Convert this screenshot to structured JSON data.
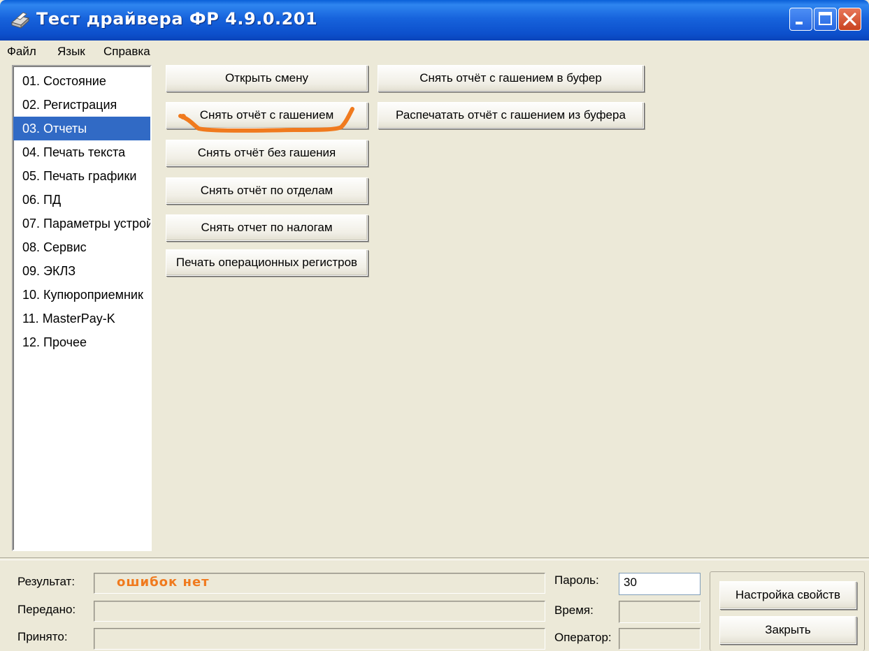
{
  "window": {
    "title": "Тест драйвера ФР 4.9.0.201",
    "icons": [
      "app-printer-icon",
      "minimize-icon",
      "maximize-icon",
      "close-icon"
    ]
  },
  "menu": [
    "Файл",
    "Язык",
    "Справка"
  ],
  "nav": {
    "items": [
      "01. Состояние",
      "02. Регистрация",
      "03. Отчеты",
      "04. Печать текста",
      "05. Печать графики",
      "06. ПД",
      "07. Параметры устрой",
      "08. Сервис",
      "09. ЭКЛЗ",
      "10. Купюроприемник",
      "11. MasterPay-K",
      "12. Прочее"
    ],
    "selected": "03. Отчеты"
  },
  "reports": {
    "col1": [
      "Открыть смену",
      "Снять отчёт с гашением",
      "Снять отчёт без гашения",
      "Снять отчёт по отделам",
      "Снять отчет по налогам",
      "Печать операционных регистров"
    ],
    "col2": [
      "Снять отчёт с гашением в буфер",
      "Распечатать отчёт с гашением из буфера"
    ]
  },
  "status": {
    "result_label": "Результат:",
    "result_value": "ошибок нет",
    "sent_label": "Передано:",
    "sent_value": "",
    "received_label": "Принято:",
    "received_value": "",
    "password_label": "Пароль:",
    "password_value": "30",
    "time_label": "Время:",
    "time_value": "",
    "operator_label": "Оператор:",
    "operator_value": ""
  },
  "actions": {
    "settings": "Настройка свойств",
    "close": "Закрыть"
  },
  "colors": {
    "titlebar": "#0a5fd8",
    "selection": "#316ac5",
    "result_text": "#f07a1e",
    "highlight_stroke": "#f07a1e",
    "background": "#ece9d8"
  }
}
